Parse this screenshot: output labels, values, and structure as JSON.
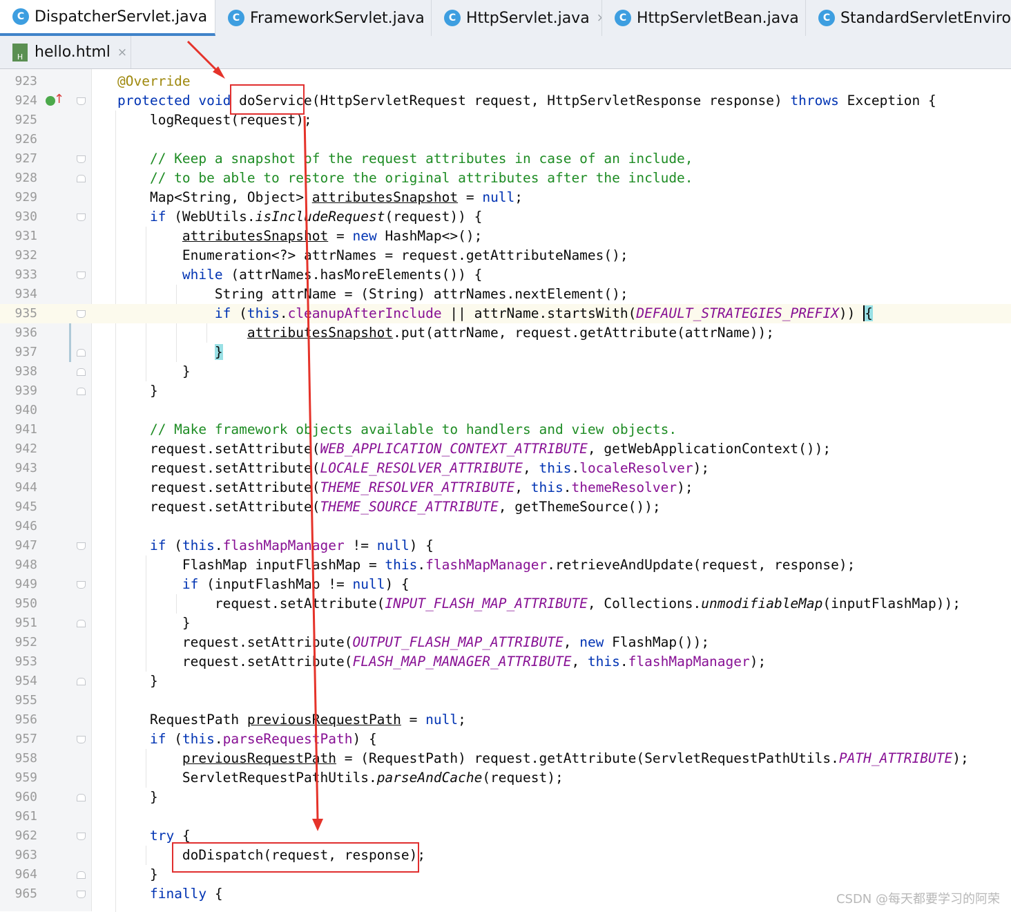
{
  "tabs_row1": [
    {
      "label": "DispatcherServlet.java",
      "icon": "class-icon",
      "active": true
    },
    {
      "label": "FrameworkServlet.java",
      "icon": "class-icon"
    },
    {
      "label": "HttpServlet.java",
      "icon": "class-icon"
    },
    {
      "label": "HttpServletBean.java",
      "icon": "class-icon"
    },
    {
      "label": "StandardServletEnvironm",
      "icon": "class-icon"
    }
  ],
  "tabs_row2": [
    {
      "label": "hello.html",
      "icon": "html-file-icon"
    }
  ],
  "tab_close_glyph": "×",
  "class_icon_glyph": "C",
  "html_icon_glyph": "H",
  "editor": {
    "current_line": 935,
    "lines": [
      {
        "n": "923",
        "code": "@Override"
      },
      {
        "n": "924",
        "code": "protected void doService(HttpServletRequest request, HttpServletResponse response) throws Exception {"
      },
      {
        "n": "925",
        "code": "    logRequest(request);"
      },
      {
        "n": "926",
        "code": ""
      },
      {
        "n": "927",
        "code": "    // Keep a snapshot of the request attributes in case of an include,"
      },
      {
        "n": "928",
        "code": "    // to be able to restore the original attributes after the include."
      },
      {
        "n": "929",
        "code": "    Map<String, Object> attributesSnapshot = null;"
      },
      {
        "n": "930",
        "code": "    if (WebUtils.isIncludeRequest(request)) {"
      },
      {
        "n": "931",
        "code": "        attributesSnapshot = new HashMap<>();"
      },
      {
        "n": "932",
        "code": "        Enumeration<?> attrNames = request.getAttributeNames();"
      },
      {
        "n": "933",
        "code": "        while (attrNames.hasMoreElements()) {"
      },
      {
        "n": "934",
        "code": "            String attrName = (String) attrNames.nextElement();"
      },
      {
        "n": "935",
        "code": "            if (this.cleanupAfterInclude || attrName.startsWith(DEFAULT_STRATEGIES_PREFIX)) {"
      },
      {
        "n": "936",
        "code": "                attributesSnapshot.put(attrName, request.getAttribute(attrName));"
      },
      {
        "n": "937",
        "code": "            }"
      },
      {
        "n": "938",
        "code": "        }"
      },
      {
        "n": "939",
        "code": "    }"
      },
      {
        "n": "940",
        "code": ""
      },
      {
        "n": "941",
        "code": "    // Make framework objects available to handlers and view objects."
      },
      {
        "n": "942",
        "code": "    request.setAttribute(WEB_APPLICATION_CONTEXT_ATTRIBUTE, getWebApplicationContext());"
      },
      {
        "n": "943",
        "code": "    request.setAttribute(LOCALE_RESOLVER_ATTRIBUTE, this.localeResolver);"
      },
      {
        "n": "944",
        "code": "    request.setAttribute(THEME_RESOLVER_ATTRIBUTE, this.themeResolver);"
      },
      {
        "n": "945",
        "code": "    request.setAttribute(THEME_SOURCE_ATTRIBUTE, getThemeSource());"
      },
      {
        "n": "946",
        "code": ""
      },
      {
        "n": "947",
        "code": "    if (this.flashMapManager != null) {"
      },
      {
        "n": "948",
        "code": "        FlashMap inputFlashMap = this.flashMapManager.retrieveAndUpdate(request, response);"
      },
      {
        "n": "949",
        "code": "        if (inputFlashMap != null) {"
      },
      {
        "n": "950",
        "code": "            request.setAttribute(INPUT_FLASH_MAP_ATTRIBUTE, Collections.unmodifiableMap(inputFlashMap));"
      },
      {
        "n": "951",
        "code": "        }"
      },
      {
        "n": "952",
        "code": "        request.setAttribute(OUTPUT_FLASH_MAP_ATTRIBUTE, new FlashMap());"
      },
      {
        "n": "953",
        "code": "        request.setAttribute(FLASH_MAP_MANAGER_ATTRIBUTE, this.flashMapManager);"
      },
      {
        "n": "954",
        "code": "    }"
      },
      {
        "n": "955",
        "code": ""
      },
      {
        "n": "956",
        "code": "    RequestPath previousRequestPath = null;"
      },
      {
        "n": "957",
        "code": "    if (this.parseRequestPath) {"
      },
      {
        "n": "958",
        "code": "        previousRequestPath = (RequestPath) request.getAttribute(ServletRequestPathUtils.PATH_ATTRIBUTE);"
      },
      {
        "n": "959",
        "code": "        ServletRequestPathUtils.parseAndCache(request);"
      },
      {
        "n": "960",
        "code": "    }"
      },
      {
        "n": "961",
        "code": ""
      },
      {
        "n": "962",
        "code": "    try {"
      },
      {
        "n": "963",
        "code": "        doDispatch(request, response);"
      },
      {
        "n": "964",
        "code": "    }"
      },
      {
        "n": "965",
        "code": "    finally {"
      }
    ]
  },
  "highlights": {
    "method_box": "doService",
    "call_box": "doDispatch(request, response);",
    "annotation_color": "#e02e2e"
  },
  "watermark": "CSDN @每天都要学习的阿荣"
}
